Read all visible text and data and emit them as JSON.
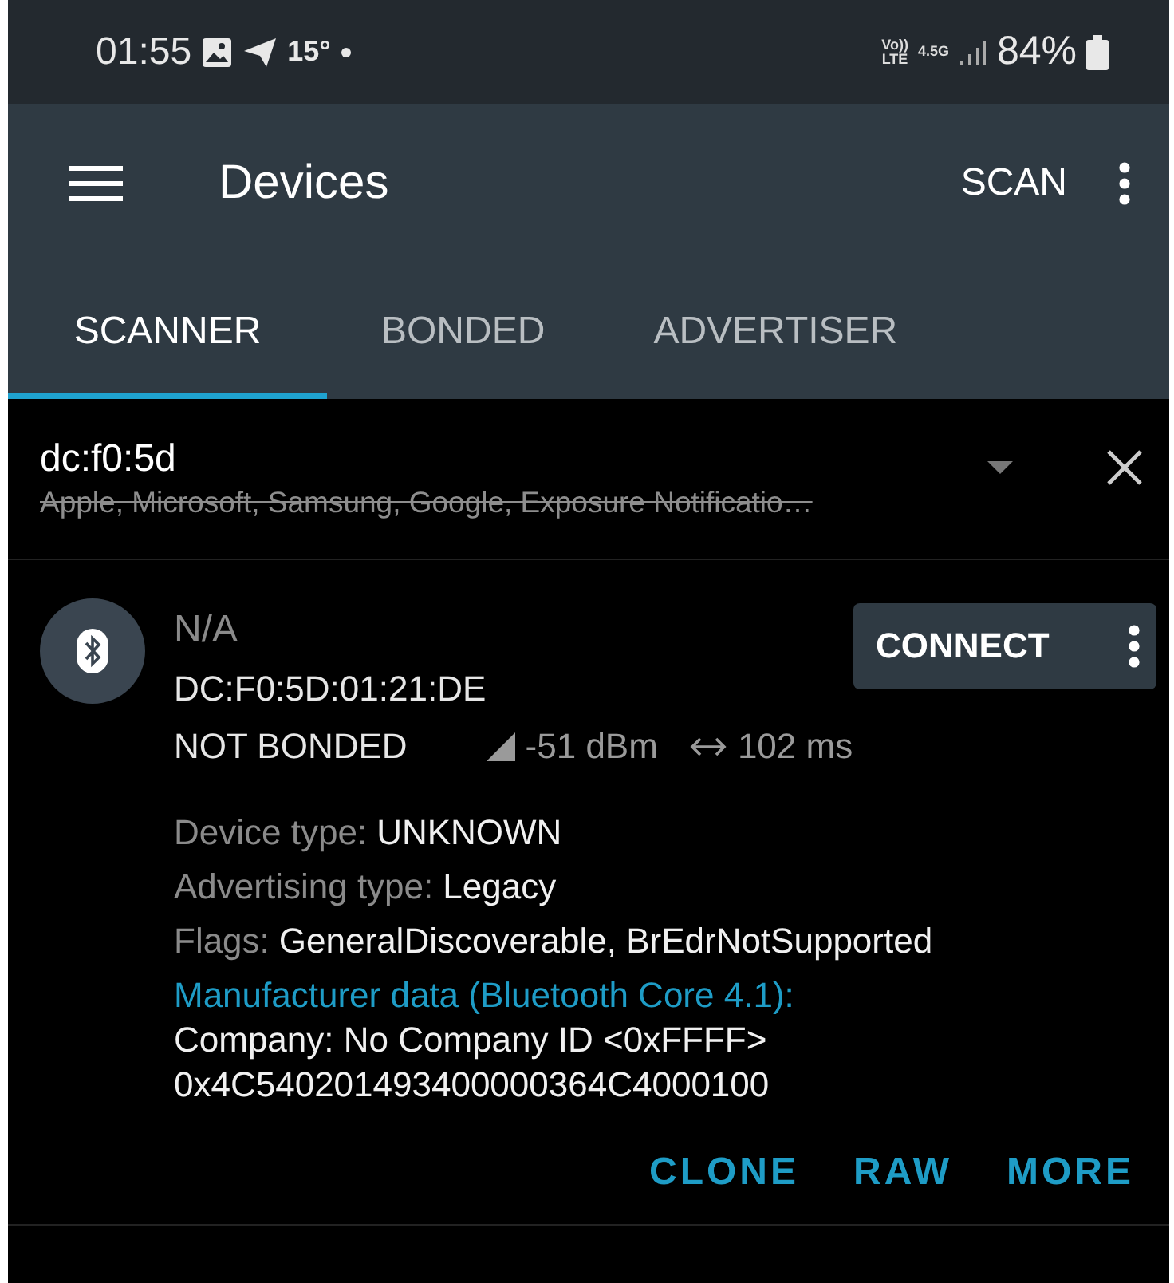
{
  "status_bar": {
    "time": "01:55",
    "temperature": "15°",
    "volte_top": "Vo))",
    "volte_bottom": "LTE",
    "network": "4.5G",
    "battery": "84%"
  },
  "toolbar": {
    "title": "Devices",
    "action": "SCAN"
  },
  "tabs": [
    {
      "label": "SCANNER",
      "selected": true
    },
    {
      "label": "BONDED",
      "selected": false
    },
    {
      "label": "ADVERTISER",
      "selected": false
    }
  ],
  "filter": {
    "query": "dc:f0:5d",
    "excluded": "Apple, Microsoft, Samsung, Google, Exposure Notificatio…"
  },
  "device": {
    "name": "N/A",
    "address": "DC:F0:5D:01:21:DE",
    "bond_state": "NOT BONDED",
    "rssi": "-51 dBm",
    "interval": "102 ms",
    "connect": "CONNECT",
    "details": [
      {
        "label": "Device type:",
        "value": "UNKNOWN"
      },
      {
        "label": "Advertising type:",
        "value": "Legacy"
      },
      {
        "label": "Flags:",
        "value": "GeneralDiscoverable, BrEdrNotSupported"
      }
    ],
    "manufacturer_heading": "Manufacturer data (Bluetooth Core 4.1):",
    "manufacturer_lines": [
      "Company: No Company ID <0xFFFF>",
      "0x4C540201493400000364C4000100"
    ],
    "actions": [
      "CLONE",
      "RAW",
      "MORE"
    ]
  }
}
